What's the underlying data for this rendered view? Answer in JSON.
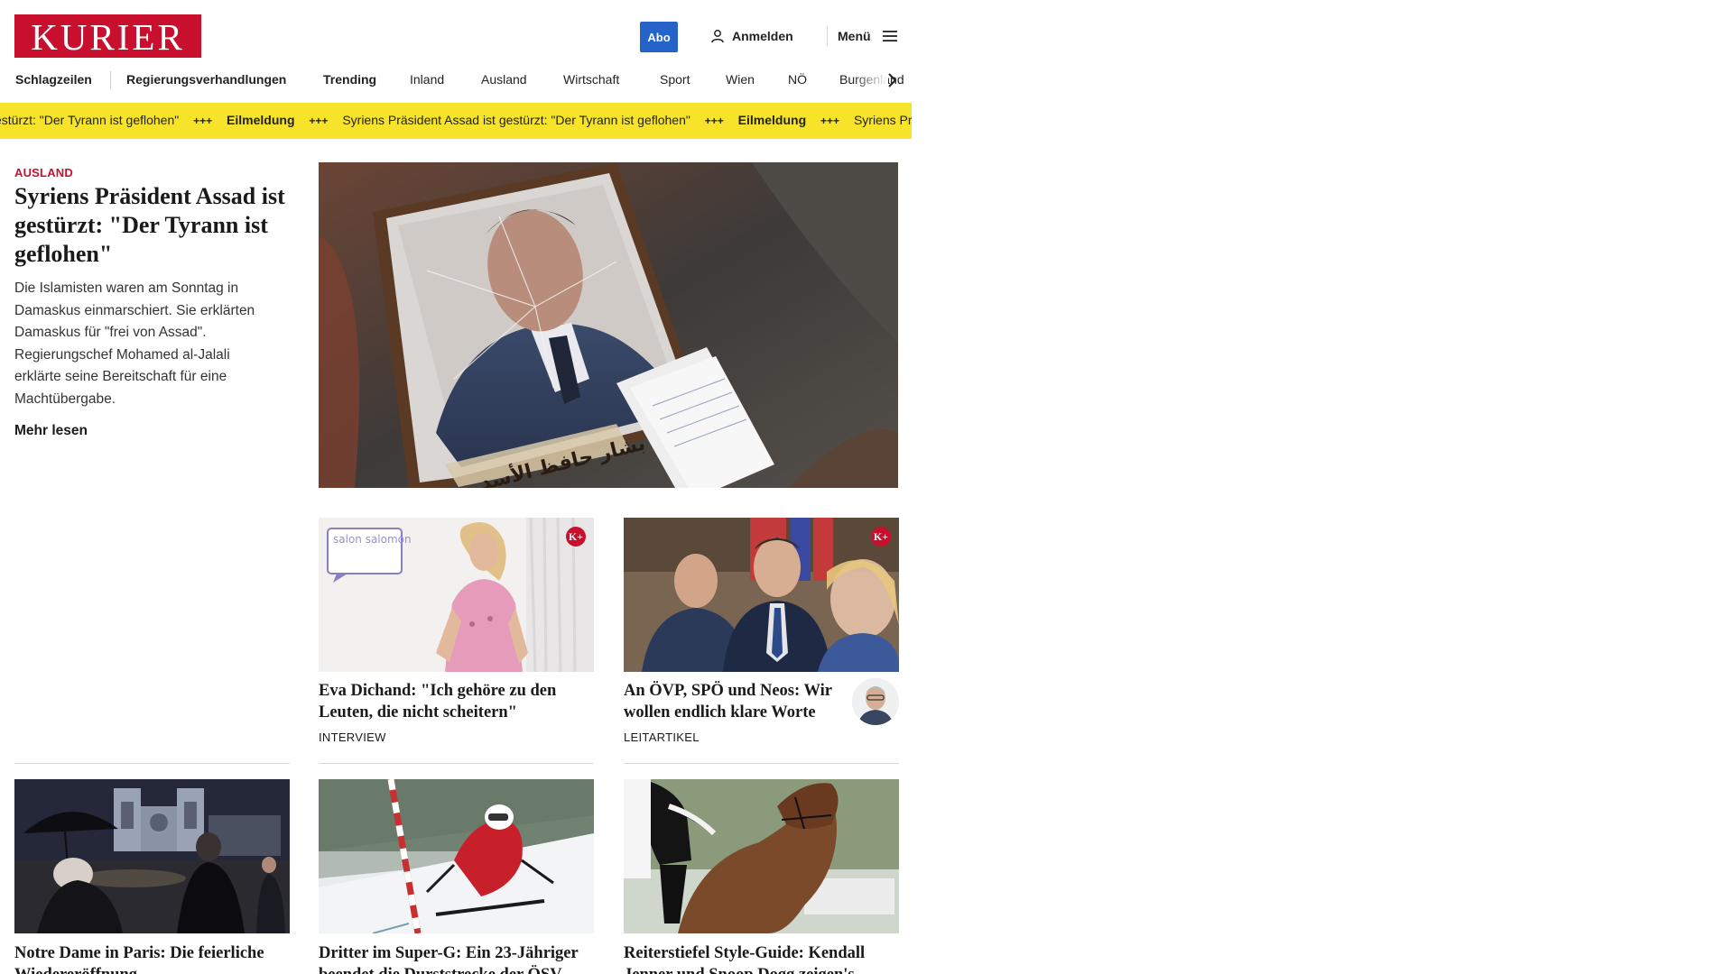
{
  "header": {
    "logo": "KURIER",
    "abo_label": "Abo",
    "login_label": "Anmelden",
    "menu_label": "Menü"
  },
  "nav": {
    "items": [
      "Schlagzeilen",
      "Regierungsverhandlungen",
      "Trending",
      "Inland",
      "Ausland",
      "Wirtschaft",
      "Sport",
      "Wien",
      "NÖ",
      "Burgenland"
    ]
  },
  "ticker": {
    "headline": "Syriens Präsident Assad ist gestürzt: \"Der Tyrann ist geflohen\"",
    "headline_cut_start": "estürzt: \"Der Tyrann ist geflohen\"",
    "headline_cut_end": "Syriens Präsident A",
    "separator": "+++",
    "flash_label": "Eilmeldung",
    "bg_color": "#f7e42a"
  },
  "lead": {
    "kicker": "AUSLAND",
    "title": "Syriens Präsident Assad ist gestürzt: \"Der Tyrann ist geflohen\"",
    "teaser": "Die Islamisten waren am Sonntag in Damaskus einmarschiert. Sie erklärten Damaskus für \"frei von Assad\". Regierungschef Mohamed al-Jalali erklärte seine Bereitschaft für eine Machtübergabe.",
    "more_label": "Mehr lesen",
    "image_icon": "framed-portrait-photo",
    "image_caption_arabic": "بشار حافظ الأسد"
  },
  "cards": [
    {
      "title": "Eva Dichand: \"Ich gehöre zu den Leuten, die nicht scheitern\"",
      "category": "INTERVIEW",
      "premium_badge": "K+",
      "image_overlay": "salon salomon"
    },
    {
      "title": "An ÖVP, SPÖ und Neos: Wir wollen endlich klare Worte",
      "category": "LEITARTIKEL",
      "premium_badge": "K+"
    },
    {
      "title": "Notre Dame in Paris: Die feierliche Wiedereröffnung"
    },
    {
      "title": "Dritter im Super-G: Ein 23-Jähriger beendet die Durststrecke der ÖSV-Herren"
    },
    {
      "title": "Reiterstiefel Style-Guide: Kendall Jenner und Snoop Dogg zeigen's"
    }
  ],
  "colors": {
    "brand_red": "#c8102e",
    "abo_blue": "#2563c9"
  }
}
